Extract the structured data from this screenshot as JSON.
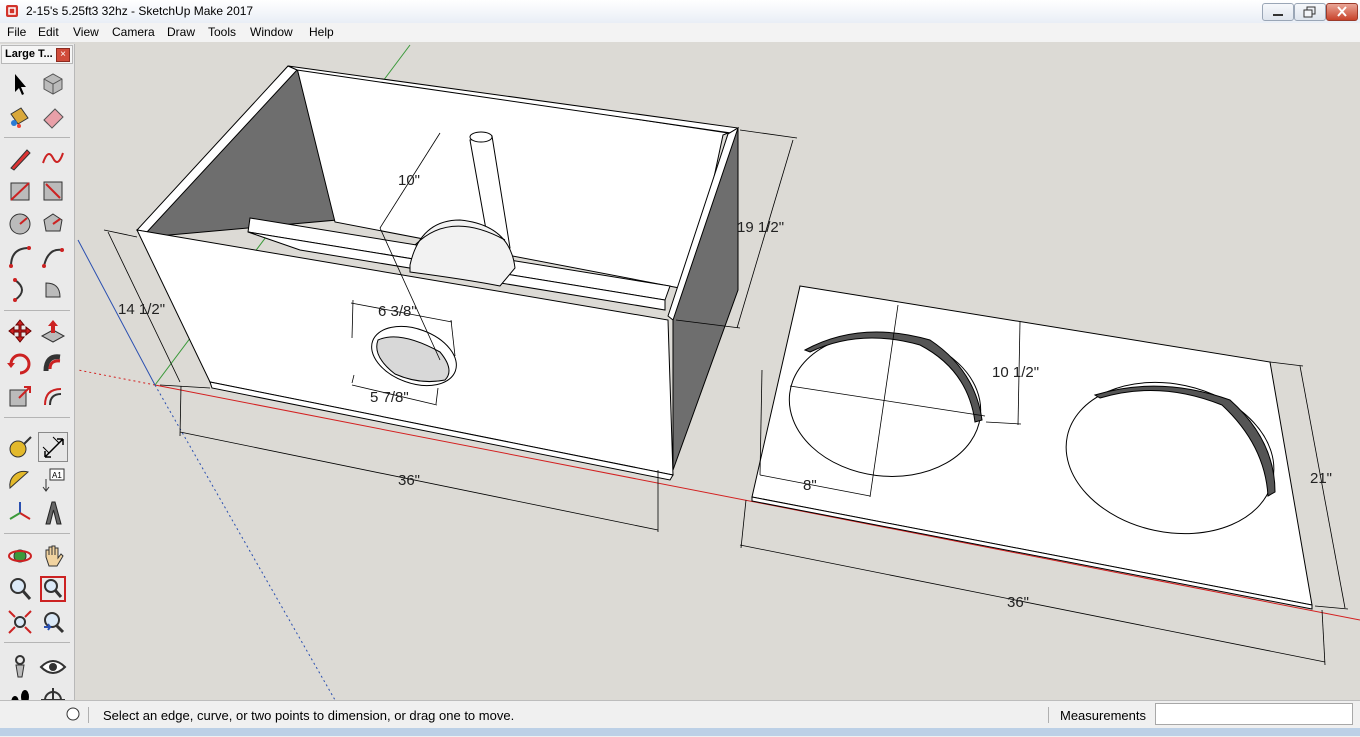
{
  "window": {
    "title": "2-15's 5.25ft3 32hz - SketchUp Make 2017"
  },
  "menu": [
    "File",
    "Edit",
    "View",
    "Camera",
    "Draw",
    "Tools",
    "Window",
    "Help"
  ],
  "toolbar": {
    "title": "Large T...",
    "tools": [
      "select",
      "component",
      "paint-bucket",
      "eraser",
      "line",
      "freehand",
      "rectangle",
      "rotated-rectangle",
      "circle",
      "polygon",
      "arc",
      "two-point-arc",
      "three-point-arc",
      "pie",
      "move",
      "push-pull",
      "rotate",
      "follow-me",
      "scale",
      "offset",
      "tape-measure",
      "dimension",
      "protractor",
      "text",
      "axes",
      "3d-text",
      "orbit",
      "pan",
      "zoom",
      "zoom-window",
      "zoom-extents",
      "previous",
      "position-camera",
      "look-around",
      "walk",
      "section-plane"
    ],
    "active_tool": "dimension"
  },
  "dimensions": {
    "box_height_inner": "10\"",
    "box_height": "19 1/2\"",
    "box_depth": "14 1/2\"",
    "port_outer": "6 3/8\"",
    "port_inner": "5 7/8\"",
    "box_width": "36\"",
    "baffle_hole_height": "10 1/2\"",
    "baffle_hole_offset": "8\"",
    "baffle_depth": "21\"",
    "baffle_width": "36\""
  },
  "status": {
    "message": "Select an edge, curve, or two points to dimension, or drag one to move.",
    "measurements_label": "Measurements",
    "measurements_value": ""
  },
  "colors": {
    "viewport_bg": "#dcdad5",
    "face_white": "#ffffff",
    "face_shade": "#6e6e6e",
    "axis_red": "#d32020",
    "axis_green": "#3b9a3b",
    "axis_blue": "#2a4fb0"
  }
}
